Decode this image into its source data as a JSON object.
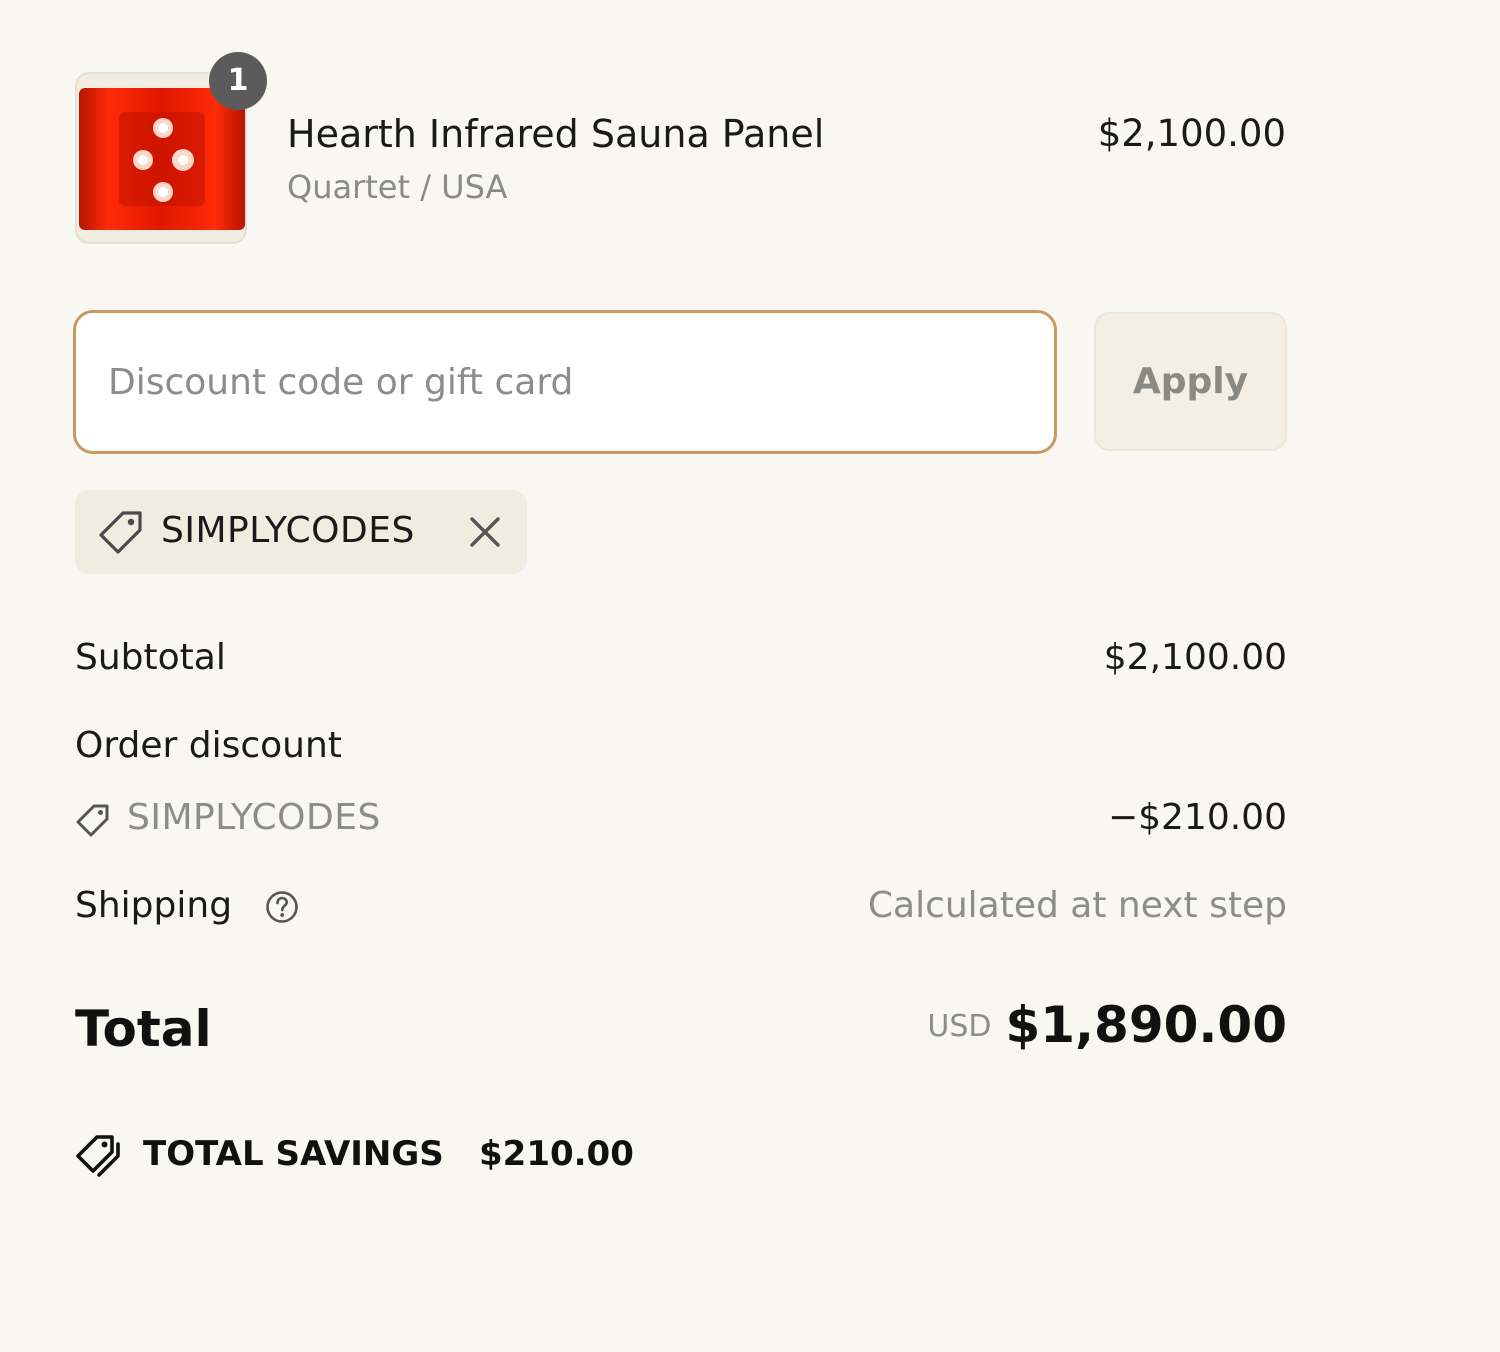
{
  "product": {
    "quantity": "1",
    "name": "Hearth Infrared Sauna Panel",
    "variant": "Quartet / USA",
    "price": "$2,100.00",
    "image_icon": "sauna-panel-thumbnail"
  },
  "discount": {
    "placeholder": "Discount code or gift card",
    "value": "",
    "apply_label": "Apply",
    "applied_code": "SIMPLYCODES"
  },
  "summary": {
    "subtotal_label": "Subtotal",
    "subtotal_value": "$2,100.00",
    "order_discount_label": "Order discount",
    "order_discount_code": "SIMPLYCODES",
    "order_discount_value": "−$210.00",
    "shipping_label": "Shipping",
    "shipping_value": "Calculated at next step",
    "total_label": "Total",
    "total_currency": "USD",
    "total_value": "$1,890.00",
    "savings_label": "TOTAL SAVINGS",
    "savings_value": "$210.00"
  },
  "colors": {
    "background": "#f9f7f2",
    "input_focus_border": "#c9995f",
    "chip_background": "#f1ece0",
    "badge": "#5b5b5b",
    "muted_text": "#8c8c88"
  }
}
